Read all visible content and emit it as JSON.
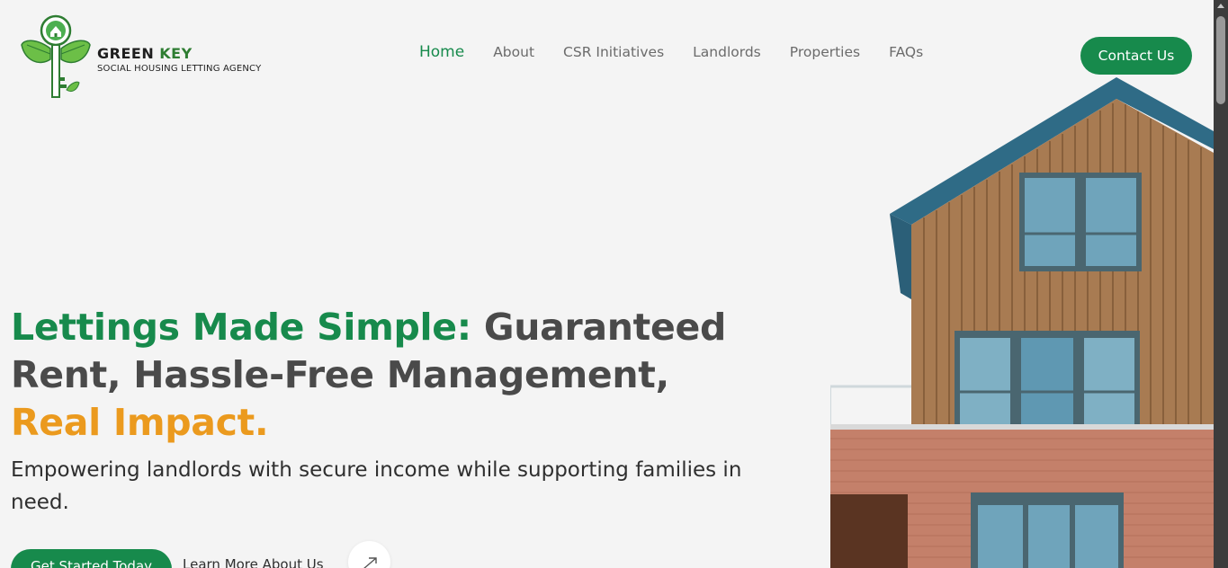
{
  "brand": {
    "name_part1": "GREEN",
    "name_part2": "KEY",
    "tagline": "SOCIAL HOUSING LETTING AGENCY",
    "color_primary": "#178a4c",
    "color_accent": "#eb9a1e"
  },
  "nav": {
    "items": [
      {
        "label": "Home",
        "active": true
      },
      {
        "label": "About"
      },
      {
        "label": "CSR Initiatives"
      },
      {
        "label": "Landlords"
      },
      {
        "label": "Properties"
      },
      {
        "label": "FAQs"
      }
    ],
    "contact_label": "Contact Us"
  },
  "hero": {
    "headline_green": "Lettings Made Simple:",
    "headline_grey": "Guaranteed Rent, Hassle-Free Management,",
    "headline_orange": "Real Impact.",
    "subheadline": "Empowering landlords with secure income while supporting families in need.",
    "primary_button": "Get Started Today",
    "secondary_link": "Learn More About Us",
    "arrow_icon": "arrow-up-right-icon"
  },
  "image": {
    "icon": "house-photo"
  }
}
